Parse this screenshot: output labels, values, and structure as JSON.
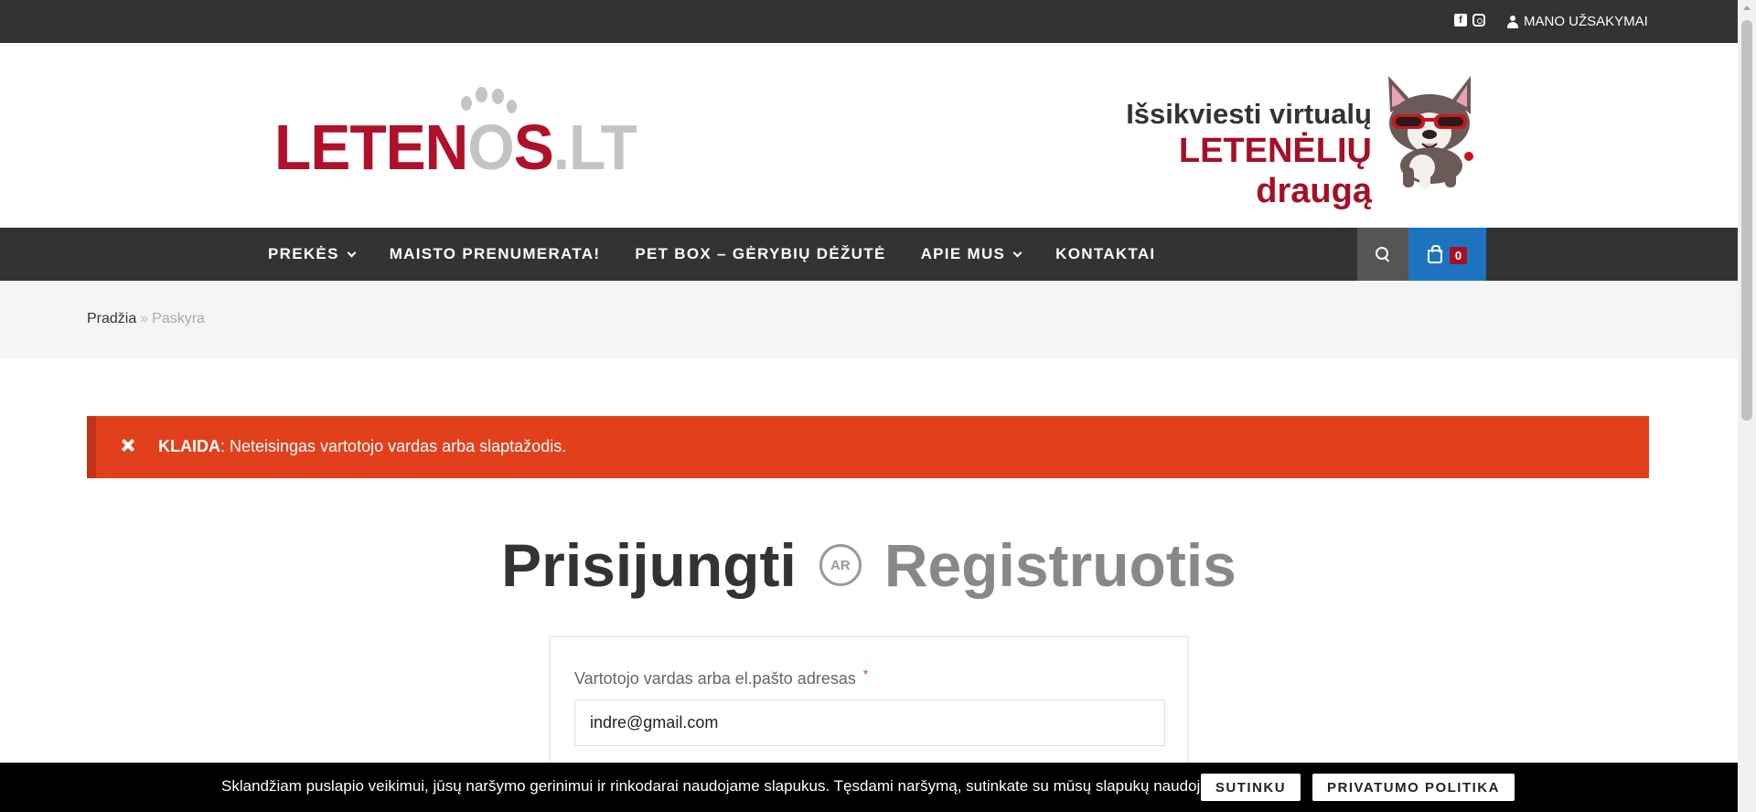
{
  "topbar": {
    "social": [
      {
        "icon": "facebook-icon"
      },
      {
        "icon": "instagram-icon"
      }
    ],
    "orders_label": "MANO UŽSAKYMAI"
  },
  "header": {
    "logo_text": {
      "part1": "LETEN",
      "part2": "O",
      "part3": "S",
      "part4": ".LT"
    },
    "promo_line1": "Išsikviesti virtualų",
    "promo_line2": "LETENĖLIŲ draugą"
  },
  "nav": {
    "items": [
      {
        "label": "PREKĖS",
        "has_dropdown": true
      },
      {
        "label": "MAISTO PRENUMERATA!",
        "has_dropdown": false
      },
      {
        "label": "PET BOX – GĖRYBIŲ DĖŽUTĖ",
        "has_dropdown": false
      },
      {
        "label": "APIE MUS",
        "has_dropdown": true
      },
      {
        "label": "KONTAKTAI",
        "has_dropdown": false
      }
    ],
    "cart_count": "0"
  },
  "breadcrumb": {
    "home": "Pradžia",
    "separator": "»",
    "current": "Paskyra"
  },
  "error": {
    "label": "KLAIDA",
    "message": ": Neteisingas vartotojo vardas arba slaptažodis."
  },
  "heading": {
    "login": "Prisijungti",
    "or": "AR",
    "register": "Registruotis"
  },
  "form": {
    "username_label": "Vartotojo vardas arba el.pašto adresas",
    "required_mark": "*",
    "username_value": "indre@gmail.com"
  },
  "cookie": {
    "text": "Sklandžiam puslapio veikimui, jūsų naršymo gerinimui ir rinkodarai naudojame slapukus. Tęsdami naršymą, sutinkate su mūsų slapukų naudojimu.",
    "accept_label": "SUTINKU",
    "privacy_label": "PRIVATUMO POLITIKA"
  },
  "colors": {
    "brand_red": "#a51027",
    "error_bg": "#e2401c",
    "cart_blue": "#1e73be",
    "dark_bar": "#333333"
  }
}
